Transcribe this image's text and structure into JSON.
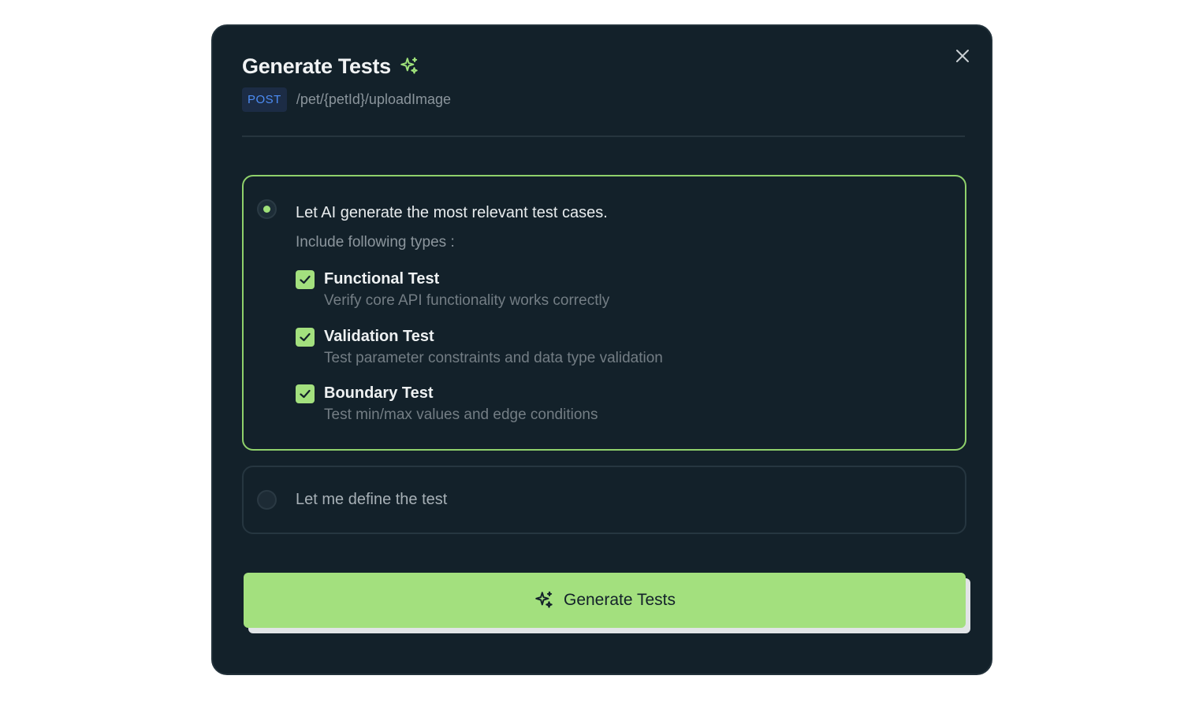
{
  "dialog": {
    "title": "Generate Tests",
    "title_icon": "sparkle-icon",
    "method": "POST",
    "endpoint": "/pet/{petId}/uploadImage",
    "close_icon": "close-icon"
  },
  "options": {
    "ai": {
      "selected": true,
      "label": "Let AI generate the most relevant test cases.",
      "include_label": "Include following types :",
      "types": [
        {
          "name": "Functional Test",
          "description": "Verify core API functionality works correctly",
          "checked": true
        },
        {
          "name": "Validation Test",
          "description": "Test parameter constraints and data type validation",
          "checked": true
        },
        {
          "name": "Boundary Test",
          "description": "Test min/max values and edge conditions",
          "checked": true
        }
      ]
    },
    "manual": {
      "selected": false,
      "label": "Let me define the test"
    }
  },
  "action": {
    "label": "Generate Tests",
    "icon": "sparkle-icon"
  },
  "colors": {
    "accent": "#a3e07e",
    "background": "#13212a",
    "method_badge": "#4d8df5"
  }
}
